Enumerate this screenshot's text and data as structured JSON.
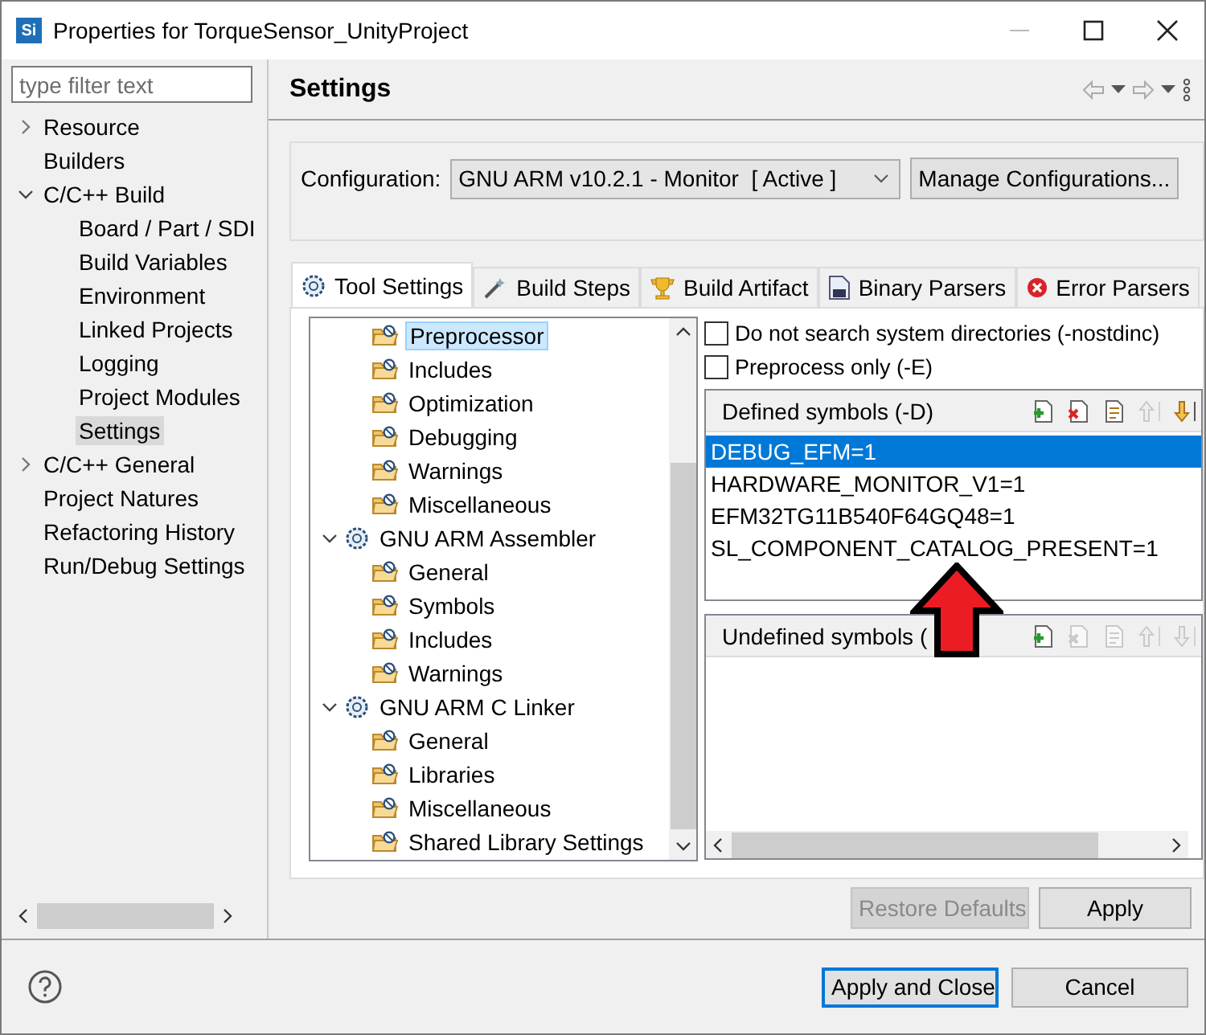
{
  "window": {
    "app_icon_text": "Si",
    "title": "Properties for TorqueSensor_UnityProject"
  },
  "sidebar": {
    "filter": {
      "placeholder": "type filter text"
    },
    "items": [
      {
        "label": "Resource",
        "expanded": false,
        "selected": false
      },
      {
        "label": "Builders",
        "selected": false
      },
      {
        "label": "C/C++ Build",
        "expanded": true,
        "selected": false,
        "children": [
          {
            "label": "Board / Part / SDI",
            "selected": false
          },
          {
            "label": "Build Variables",
            "selected": false
          },
          {
            "label": "Environment",
            "selected": false
          },
          {
            "label": "Linked Projects",
            "selected": false
          },
          {
            "label": "Logging",
            "selected": false
          },
          {
            "label": "Project Modules",
            "selected": false
          },
          {
            "label": "Settings",
            "selected": true
          }
        ]
      },
      {
        "label": "C/C++ General",
        "expanded": false,
        "selected": false
      },
      {
        "label": "Project Natures",
        "selected": false
      },
      {
        "label": "Refactoring History",
        "selected": false
      },
      {
        "label": "Run/Debug Settings",
        "selected": false
      }
    ]
  },
  "page": {
    "title": "Settings",
    "configuration": {
      "label": "Configuration:",
      "value": "GNU ARM v10.2.1 - Monitor  [ Active ]",
      "manage_button": "Manage Configurations..."
    },
    "tabs": [
      {
        "label": "Tool Settings",
        "kind": "gear",
        "selected": true
      },
      {
        "label": "Build Steps",
        "kind": "wand",
        "selected": false
      },
      {
        "label": "Build Artifact",
        "kind": "trophy",
        "selected": false
      },
      {
        "label": "Binary Parsers",
        "kind": "binary",
        "selected": false
      },
      {
        "label": "Error Parsers",
        "kind": "error",
        "selected": false
      }
    ],
    "tool_tree": {
      "scrolled_items": [
        {
          "label": "Preprocessor",
          "selected": true
        },
        {
          "label": "Includes",
          "selected": false
        },
        {
          "label": "Optimization",
          "selected": false
        },
        {
          "label": "Debugging",
          "selected": false
        },
        {
          "label": "Warnings",
          "selected": false
        },
        {
          "label": "Miscellaneous",
          "selected": false
        }
      ],
      "tools": [
        {
          "label": "GNU ARM Assembler",
          "expanded": true,
          "children": [
            {
              "label": "General",
              "selected": false
            },
            {
              "label": "Symbols",
              "selected": false
            },
            {
              "label": "Includes",
              "selected": false
            },
            {
              "label": "Warnings",
              "selected": false
            }
          ]
        },
        {
          "label": "GNU ARM C Linker",
          "expanded": true,
          "children": [
            {
              "label": "General",
              "selected": false
            },
            {
              "label": "Libraries",
              "selected": false
            },
            {
              "label": "Miscellaneous",
              "selected": false
            },
            {
              "label": "Shared Library Settings",
              "selected": false
            }
          ]
        }
      ]
    },
    "options": [
      {
        "label": "Do not search system directories (-nostdinc)",
        "checked": false
      },
      {
        "label": "Preprocess only (-E)",
        "checked": false
      }
    ],
    "defined_symbols": {
      "title": "Defined symbols (-D)",
      "tools": [
        {
          "kind": "add",
          "disabled": false
        },
        {
          "kind": "delete",
          "disabled": false
        },
        {
          "kind": "edit",
          "disabled": false
        },
        {
          "kind": "up",
          "disabled": true
        },
        {
          "kind": "down",
          "disabled": false
        }
      ],
      "rows": [
        {
          "text": "DEBUG_EFM=1",
          "selected": true
        },
        {
          "text": "HARDWARE_MONITOR_V1=1",
          "selected": false
        },
        {
          "text": "EFM32TG11B540F64GQ48=1",
          "selected": false
        },
        {
          "text": "SL_COMPONENT_CATALOG_PRESENT=1",
          "selected": false
        }
      ]
    },
    "undefined_symbols": {
      "title": "Undefined symbols (",
      "tools": [
        {
          "kind": "add",
          "disabled": false
        },
        {
          "kind": "delete",
          "disabled": true
        },
        {
          "kind": "edit",
          "disabled": true
        },
        {
          "kind": "up",
          "disabled": true
        },
        {
          "kind": "down",
          "disabled": true
        }
      ]
    },
    "restore_button": {
      "label": "Restore Defaults",
      "disabled": true
    },
    "apply_button": {
      "label": "Apply",
      "disabled": false
    }
  },
  "footer": {
    "buttons": [
      {
        "label": "Apply and Close",
        "default": true
      },
      {
        "label": "Cancel",
        "default": false
      }
    ]
  }
}
